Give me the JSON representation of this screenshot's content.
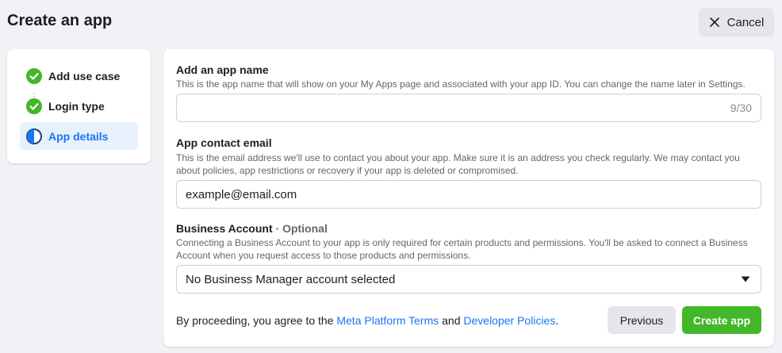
{
  "header": {
    "title": "Create an app",
    "cancel_label": "Cancel"
  },
  "stepper": {
    "items": [
      {
        "label": "Add use case",
        "state": "done",
        "icon": "check-circle-icon"
      },
      {
        "label": "Login type",
        "state": "done",
        "icon": "check-circle-icon"
      },
      {
        "label": "App details",
        "state": "active",
        "icon": "half-circle-icon"
      }
    ]
  },
  "form": {
    "app_name": {
      "title": "Add an app name",
      "description": "This is the app name that will show on your My Apps page and associated with your app ID. You can change the name later in Settings.",
      "value": "",
      "counter": "9/30"
    },
    "contact_email": {
      "title": "App contact email",
      "description": "This is the email address we'll use to contact you about your app. Make sure it is an address you check regularly. We may contact you about policies, app restrictions or recovery if your app is deleted or compromised.",
      "value": "example@email.com"
    },
    "business_account": {
      "title": "Business Account",
      "optional_label": " · Optional",
      "description": "Connecting a Business Account to your app is only required for certain products and permissions. You'll be asked to connect a Business Account when you request access to those products and permissions.",
      "selected": "No Business Manager account selected"
    }
  },
  "footer": {
    "agree_prefix": "By proceeding, you agree to the ",
    "terms_link": "Meta Platform Terms",
    "and_text": " and ",
    "policies_link": "Developer Policies",
    "suffix": ".",
    "previous_label": "Previous",
    "create_label": "Create app"
  },
  "colors": {
    "accent": "#1877f2",
    "success": "#42b72a",
    "background": "#f0f2f5"
  }
}
